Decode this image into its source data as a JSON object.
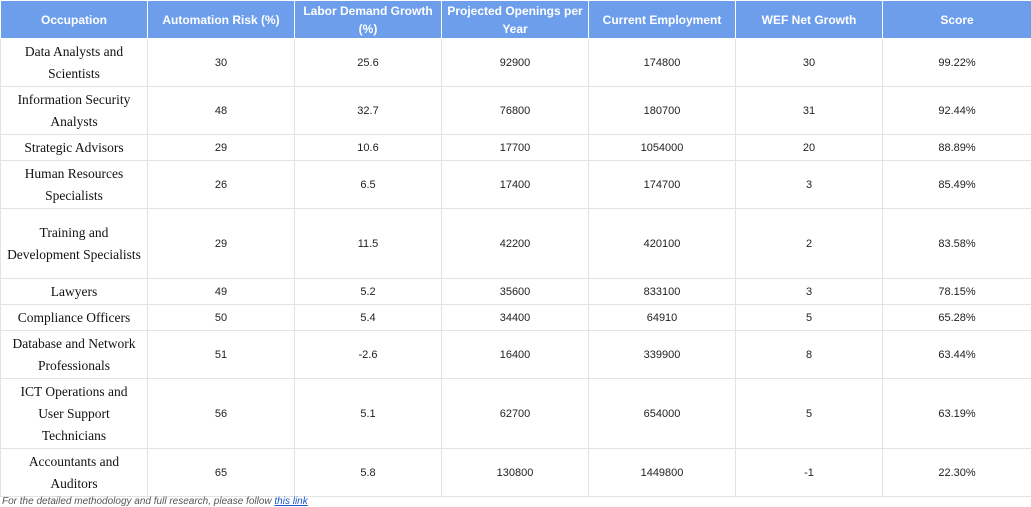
{
  "table": {
    "headers": [
      "Occupation",
      "Automation Risk (%)",
      "Labor Demand Growth (%)",
      "Projected Openings per Year",
      "Current Employment",
      "WEF Net Growth",
      "Score"
    ],
    "rows": [
      [
        "Data Analysts and Scientists",
        "30",
        "25.6",
        "92900",
        "174800",
        "30",
        "99.22%"
      ],
      [
        "Information Security Analysts",
        "48",
        "32.7",
        "76800",
        "180700",
        "31",
        "92.44%"
      ],
      [
        "Strategic Advisors",
        "29",
        "10.6",
        "17700",
        "1054000",
        "20",
        "88.89%"
      ],
      [
        "Human Resources Specialists",
        "26",
        "6.5",
        "17400",
        "174700",
        "3",
        "85.49%"
      ],
      [
        "Training and Development Specialists",
        "29",
        "11.5",
        "42200",
        "420100",
        "2",
        "83.58%"
      ],
      [
        "Lawyers",
        "49",
        "5.2",
        "35600",
        "833100",
        "3",
        "78.15%"
      ],
      [
        "Compliance Officers",
        "50",
        "5.4",
        "34400",
        "64910",
        "5",
        "65.28%"
      ],
      [
        "Database and Network Professionals",
        "51",
        "-2.6",
        "16400",
        "339900",
        "8",
        "63.44%"
      ],
      [
        "ICT Operations and User Support Technicians",
        "56",
        "5.1",
        "62700",
        "654000",
        "5",
        "63.19%"
      ],
      [
        "Accountants and Auditors",
        "65",
        "5.8",
        "130800",
        "1449800",
        "-1",
        "22.30%"
      ]
    ]
  },
  "footnote": {
    "text": "For the detailed methodology and full research, please follow ",
    "link_label": "this link"
  }
}
